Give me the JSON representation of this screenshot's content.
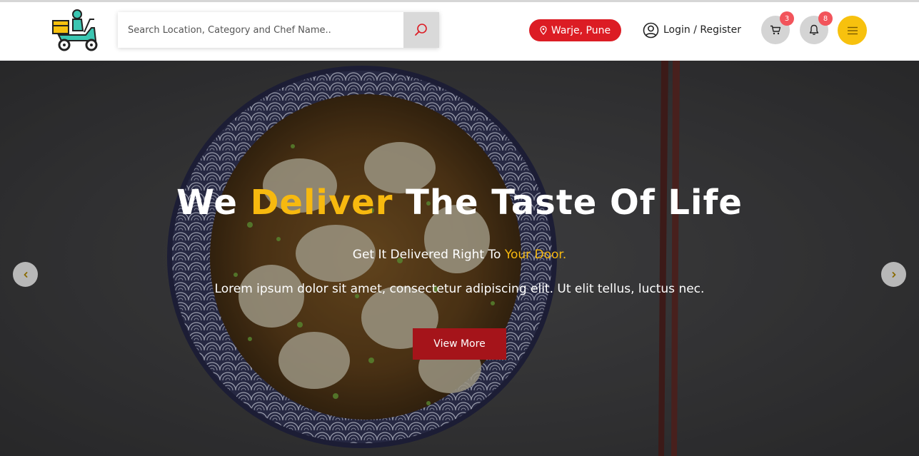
{
  "search": {
    "placeholder": "Search Location, Category and Chef Name.."
  },
  "location": {
    "label": "Warje, Pune"
  },
  "auth": {
    "label": "Login / Register"
  },
  "cart": {
    "count": "3"
  },
  "notifications": {
    "count": "8"
  },
  "hero": {
    "title_pre": "We ",
    "title_highlight": "Deliver",
    "title_post": " The Taste Of Life",
    "subtitle_pre": "Get It Delivered Right To ",
    "subtitle_highlight": "Your Door.",
    "description": "Lorem ipsum dolor sit amet, consectetur adipiscing elit. Ut elit tellus, luctus nec.",
    "button_label": "View More"
  },
  "icons": {
    "logo": "scooter-delivery-logo",
    "search": "search-icon",
    "location": "location-pin-icon",
    "user": "user-circle-icon",
    "cart": "cart-icon",
    "bell": "bell-icon",
    "menu": "hamburger-icon",
    "prev": "chevron-left-icon",
    "next": "chevron-right-icon"
  },
  "colors": {
    "accent_red": "#dc1c24",
    "button_red": "#a5141a",
    "accent_yellow": "#f7b90f",
    "badge_red": "#f2545b"
  }
}
